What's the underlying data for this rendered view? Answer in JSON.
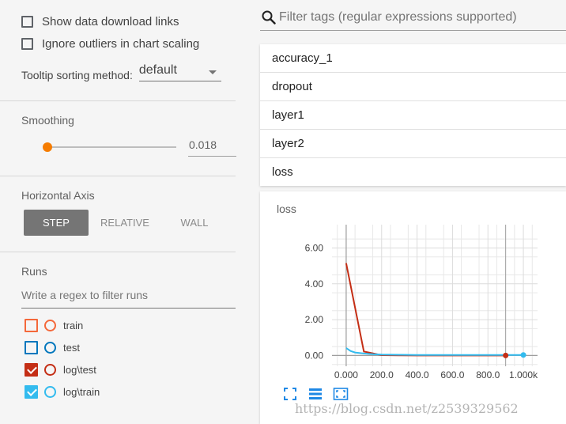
{
  "options": {
    "show_download_links": {
      "label": "Show data download links",
      "checked": false
    },
    "ignore_outliers": {
      "label": "Ignore outliers in chart scaling",
      "checked": false
    },
    "tooltip_sort": {
      "label": "Tooltip sorting method:",
      "value": "default"
    }
  },
  "smoothing": {
    "title": "Smoothing",
    "value": "0.018",
    "fraction": 0.018
  },
  "horizontal_axis": {
    "title": "Horizontal Axis",
    "buttons": [
      "STEP",
      "RELATIVE",
      "WALL"
    ],
    "selected": "STEP"
  },
  "runs": {
    "title": "Runs",
    "filter_placeholder": "Write a regex to filter runs",
    "items": [
      {
        "label": "train",
        "color": "#f4683a",
        "checked": false
      },
      {
        "label": "test",
        "color": "#0277bd",
        "checked": false
      },
      {
        "label": "log\\test",
        "color": "#c42e15",
        "checked": true
      },
      {
        "label": "log\\train",
        "color": "#33bbee",
        "checked": true
      }
    ]
  },
  "search": {
    "placeholder": "Filter tags (regular expressions supported)",
    "icon": "search-icon"
  },
  "tags": [
    "accuracy_1",
    "dropout",
    "layer1",
    "layer2",
    "loss"
  ],
  "chart_tools": [
    "fit-domain-icon",
    "toggle-log-scale-icon",
    "expand-chart-icon"
  ],
  "watermark": "https://blog.csdn.net/z2539329562",
  "chart_data": {
    "type": "line",
    "title": "loss",
    "xlabel": "",
    "ylabel": "",
    "xlim": [
      -80,
      1080
    ],
    "ylim": [
      -0.6,
      7.3
    ],
    "x_tick_labels": [
      "0.000",
      "200.0",
      "400.0",
      "600.0",
      "800.0",
      "1.000k"
    ],
    "x_ticks": [
      0,
      200,
      400,
      600,
      800,
      1000
    ],
    "y_tick_labels": [
      "0.00",
      "2.00",
      "4.00",
      "6.00"
    ],
    "y_ticks": [
      0,
      2,
      4,
      6
    ],
    "grid": true,
    "series": [
      {
        "name": "log\\test",
        "color": "#c42e15",
        "x": [
          0,
          100,
          200,
          300,
          400,
          500,
          600,
          700,
          800,
          900
        ],
        "y": [
          5.15,
          0.22,
          0.02,
          0.01,
          0.0,
          0.0,
          0.0,
          0.0,
          0.0,
          0.0
        ]
      },
      {
        "name": "log\\train",
        "color": "#33bbee",
        "x": [
          0,
          25,
          50,
          100,
          150,
          200,
          300,
          400,
          500,
          600,
          700,
          800,
          900,
          1000
        ],
        "y": [
          0.42,
          0.25,
          0.17,
          0.11,
          0.07,
          0.05,
          0.04,
          0.03,
          0.03,
          0.03,
          0.03,
          0.03,
          0.03,
          0.03
        ]
      }
    ]
  }
}
